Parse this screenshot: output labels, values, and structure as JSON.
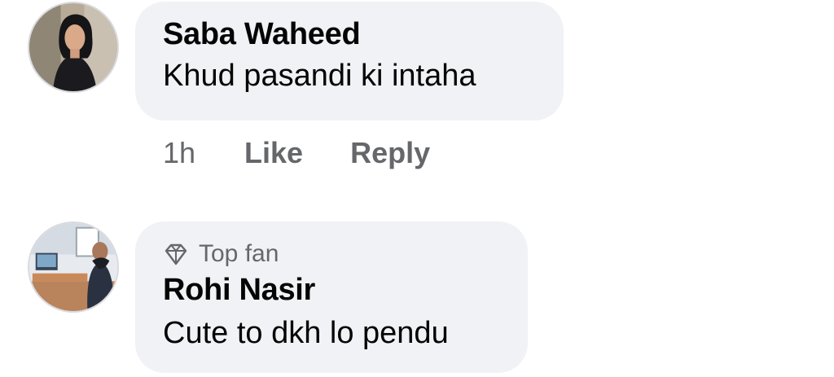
{
  "comments": [
    {
      "author": "Saba Waheed",
      "text": "Khud pasandi ki intaha",
      "time": "1h",
      "like_label": "Like",
      "reply_label": "Reply"
    },
    {
      "badge_icon": "diamond-icon",
      "badge": "Top fan",
      "author": "Rohi Nasir",
      "text": "Cute to dkh lo pendu"
    }
  ]
}
